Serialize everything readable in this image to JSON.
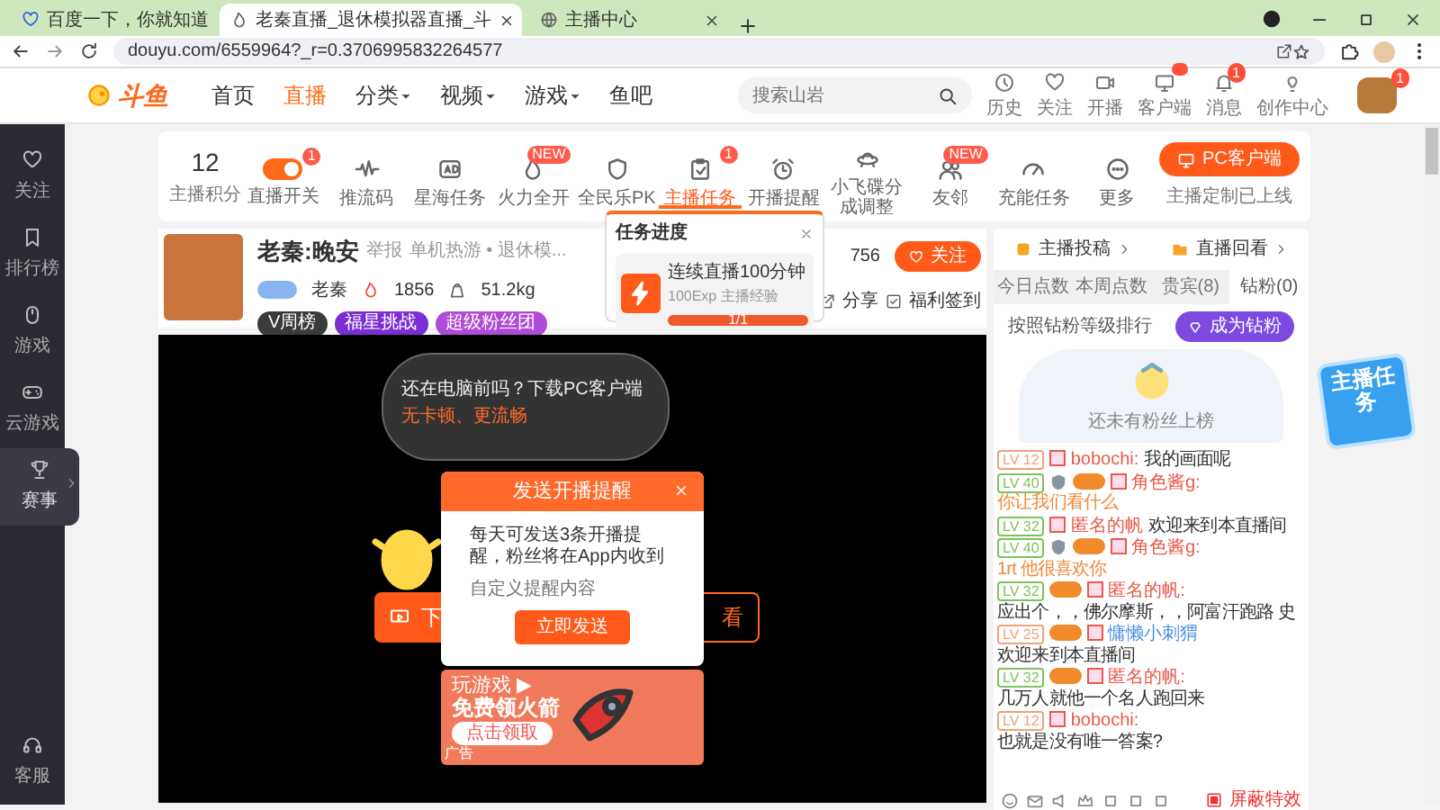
{
  "browser_tabs": [
    {
      "title": "百度一下，你就知道",
      "selected": false
    },
    {
      "title": "老秦直播_退休模拟器直播_斗",
      "selected": true
    },
    {
      "title": "主播中心",
      "selected": false
    }
  ],
  "address_bar": {
    "url": "douyu.com/6559964?_r=0.3706995832264577"
  },
  "site_nav": {
    "logo": "斗鱼",
    "links": [
      {
        "label": "首页",
        "selected": false,
        "dropdown": false
      },
      {
        "label": "直播",
        "selected": true,
        "dropdown": false
      },
      {
        "label": "分类",
        "selected": false,
        "dropdown": true
      },
      {
        "label": "视频",
        "selected": false,
        "dropdown": true
      },
      {
        "label": "游戏",
        "selected": false,
        "dropdown": true
      },
      {
        "label": "鱼吧",
        "selected": false,
        "dropdown": false
      }
    ],
    "search": {
      "placeholder": "搜索山岩"
    },
    "actions": [
      {
        "label": "历史"
      },
      {
        "label": "关注"
      },
      {
        "label": "开播"
      },
      {
        "label": "客户端",
        "dot": true
      },
      {
        "label": "消息",
        "badge": "1"
      },
      {
        "label": "创作中心"
      }
    ],
    "avatar_badge": "1"
  },
  "sidebar": {
    "items": [
      {
        "label": "关注",
        "selected": false
      },
      {
        "label": "排行榜",
        "selected": false
      },
      {
        "label": "游戏",
        "selected": false
      },
      {
        "label": "云游戏",
        "selected": false
      },
      {
        "label": "赛事",
        "selected": true
      }
    ],
    "support": "客服"
  },
  "toolbar": {
    "score": "12",
    "score_label": "主播积分",
    "items": [
      {
        "kind": "toggle",
        "on": true,
        "label": "直播开关",
        "badge": "1",
        "selected": false
      },
      {
        "kind": "icon",
        "label": "推流码",
        "selected": false
      },
      {
        "kind": "icon",
        "label": "星海任务",
        "selected": false
      },
      {
        "kind": "icon",
        "label": "火力全开",
        "badge": "NEW",
        "selected": false
      },
      {
        "kind": "icon",
        "label": "全民乐PK",
        "selected": false
      },
      {
        "kind": "icon",
        "label": "主播任务",
        "badge": "1",
        "selected": true
      },
      {
        "kind": "icon",
        "label": "开播提醒",
        "selected": false
      },
      {
        "kind": "icon",
        "label": "小飞碟分成调整",
        "selected": false
      },
      {
        "kind": "icon",
        "label": "友邻",
        "badge": "NEW",
        "selected": false
      },
      {
        "kind": "icon",
        "label": "充能任务",
        "selected": false
      },
      {
        "kind": "icon",
        "label": "更多",
        "selected": false
      }
    ],
    "client_button": "PC客户端",
    "client_note": "主播定制已上线"
  },
  "streamer": {
    "name": "老秦:晚安",
    "report": "举报",
    "category": "单机热游 • 退休模...",
    "host": "老秦",
    "heat": "1856",
    "weight": "51.2kg",
    "tags": [
      {
        "label": "V周榜",
        "color": "#3b3b3b"
      },
      {
        "label": "福星挑战",
        "color": "#7a2ed4"
      },
      {
        "label": "超级粉丝团",
        "color": "#b04ad8"
      }
    ],
    "followers": "756",
    "follow_button": "关注",
    "share": "分享",
    "checkin": "福利签到"
  },
  "task_popup": {
    "title": "任务进度",
    "task": "连续直播100分钟",
    "reward": "100Exp 主播经验",
    "progress_text": "1/1",
    "level": 1
  },
  "video": {
    "bubble_line1": "还在电脑前吗？下载PC客户端",
    "bubble_line2": "无卡顿、更流畅",
    "download_button": "下",
    "watch_button": "看"
  },
  "reminder_modal": {
    "title": "发送开播提醒",
    "body": "每天可发送3条开播提醒，粉丝将在App内收到",
    "placeholder": "自定义提醒内容",
    "button": "立即发送"
  },
  "ad": {
    "line1": "玩游戏 ▶",
    "line2": "免费领火箭",
    "button": "点击领取",
    "tag": "广告"
  },
  "right_panel": {
    "links": [
      "主播投稿",
      "直播回看"
    ],
    "tabs": [
      {
        "label": "今日点数",
        "selected": false
      },
      {
        "label": "本周点数",
        "selected": false
      },
      {
        "label": "贵宾(8)",
        "selected": false
      },
      {
        "label": "钻粉(0)",
        "selected": true
      }
    ],
    "rank_note": "按照钻粉等级排行",
    "join_button": "成为钻粉",
    "empty_text": "还未有粉丝上榜",
    "chat": [
      {
        "level": "LV 12",
        "color": "#f0a27a",
        "medal": false,
        "fan_badge": false,
        "name": "bobochi:",
        "text": "我的画面呢",
        "highlight": false
      },
      {
        "level": "LV 40",
        "color": "#7cc35a",
        "medal": true,
        "fan_badge": true,
        "name": "角色酱g:",
        "text": "你让我们看什么",
        "highlight": true
      },
      {
        "level": "LV 32",
        "color": "#7cc35a",
        "medal": false,
        "fan_badge": false,
        "name": "匿名的帆",
        "text": "欢迎来到本直播间",
        "highlight": false
      },
      {
        "level": "LV 40",
        "color": "#7cc35a",
        "medal": true,
        "fan_badge": true,
        "name": "角色酱g:",
        "text": "1rt 他很喜欢你",
        "highlight": true
      },
      {
        "level": "LV 32",
        "color": "#7cc35a",
        "medal": false,
        "fan_badge": true,
        "name": "匿名的帆:",
        "text": "应出个，，佛尔摩斯，，阿富汗跑路 史",
        "highlight": false
      },
      {
        "level": "LV 25",
        "color": "#f0a27a",
        "medal": false,
        "fan_badge": true,
        "name": "慵懒小刺猬",
        "text": "欢迎来到本直播间",
        "highlight": false
      },
      {
        "level": "LV 32",
        "color": "#7cc35a",
        "medal": false,
        "fan_badge": true,
        "name": "匿名的帆:",
        "text": "几万人就他一个名人跑回来",
        "highlight": false
      },
      {
        "level": "LV 12",
        "color": "#f0a27a",
        "medal": false,
        "fan_badge": false,
        "name": "bobochi:",
        "text": "也就是没有唯一答案?",
        "highlight": false
      }
    ],
    "shield_effects": "屏蔽特效"
  },
  "task_badge": "主播任务"
}
